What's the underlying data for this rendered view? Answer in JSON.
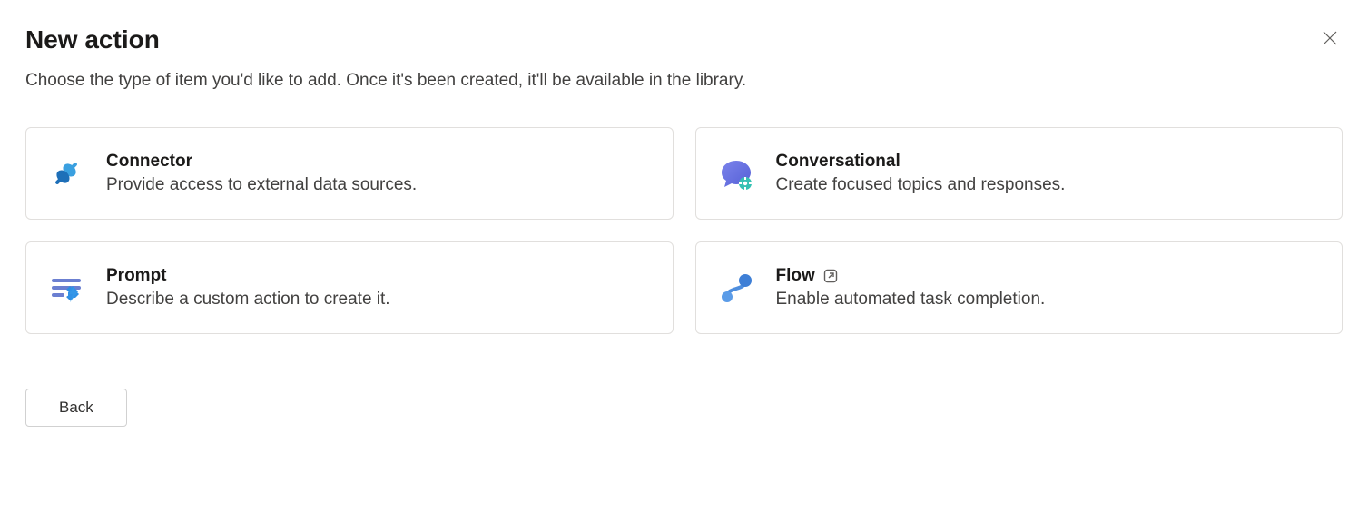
{
  "header": {
    "title": "New action",
    "subtitle": "Choose the type of item you'd like to add. Once it's been created, it'll be available in the library."
  },
  "cards": {
    "connector": {
      "title": "Connector",
      "desc": "Provide access to external data sources."
    },
    "conversational": {
      "title": "Conversational",
      "desc": "Create focused topics and responses."
    },
    "prompt": {
      "title": "Prompt",
      "desc": "Describe a custom action to create it."
    },
    "flow": {
      "title": "Flow",
      "desc": "Enable automated task completion."
    }
  },
  "footer": {
    "back_label": "Back"
  }
}
